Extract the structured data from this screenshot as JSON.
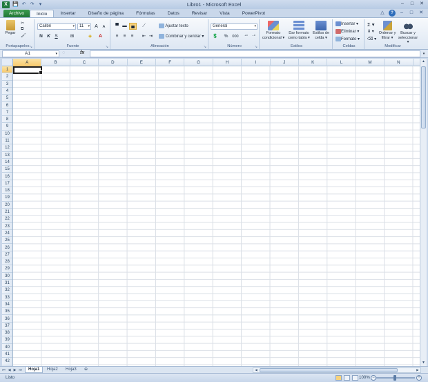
{
  "window": {
    "title": "Libro1 - Microsoft Excel",
    "app_letter": "X",
    "controls": [
      "–",
      "□",
      "✕"
    ]
  },
  "qat": [
    "💾",
    "↶",
    "↷",
    "▾"
  ],
  "tabs": [
    {
      "label": "Archivo"
    },
    {
      "label": "Inicio"
    },
    {
      "label": "Insertar"
    },
    {
      "label": "Diseño de página"
    },
    {
      "label": "Fórmulas"
    },
    {
      "label": "Datos"
    },
    {
      "label": "Revisar"
    },
    {
      "label": "Vista"
    },
    {
      "label": "PowerPivot"
    }
  ],
  "tab_right": {
    "minimize": "△",
    "help": "?",
    "min": "–",
    "restore": "□",
    "close": "✕"
  },
  "ribbon": {
    "portapapeles": {
      "label": "Portapapeles",
      "paste": "Pegar"
    },
    "fuente": {
      "label": "Fuente",
      "font": "Calibri",
      "size": "11",
      "grow": "A",
      "shrink": "A",
      "bold": "N",
      "italic": "K",
      "underline": "S"
    },
    "alineacion": {
      "label": "Alineación",
      "wrap": "Ajustar texto",
      "merge": "Combinar y centrar"
    },
    "numero": {
      "label": "Número",
      "format": "General",
      "percent": "%",
      "thousands": "000"
    },
    "estilos": {
      "label": "Estilos",
      "cond": "Formato condicional",
      "table": "Dar formato como tabla",
      "cell": "Estilos de celda"
    },
    "celdas": {
      "label": "Celdas",
      "insert": "Insertar",
      "delete": "Eliminar",
      "format": "Formato"
    },
    "modificar": {
      "label": "Modificar",
      "sort": "Ordenar y filtrar",
      "find": "Buscar y seleccionar",
      "sum": "Σ"
    }
  },
  "formula_bar": {
    "name_box": "A1",
    "fx": "fx",
    "value": ""
  },
  "grid": {
    "columns": [
      "A",
      "B",
      "C",
      "D",
      "E",
      "F",
      "G",
      "H",
      "I",
      "J",
      "K",
      "L",
      "M",
      "N"
    ],
    "rows": [
      "1",
      "2",
      "3",
      "4",
      "5",
      "6",
      "7",
      "8",
      "9",
      "10",
      "11",
      "12",
      "13",
      "14",
      "15",
      "16",
      "17",
      "18",
      "19",
      "20",
      "21",
      "22",
      "23",
      "24",
      "25",
      "26",
      "27",
      "28",
      "29",
      "30",
      "31",
      "32",
      "33",
      "34",
      "35",
      "36",
      "37",
      "38",
      "39",
      "40",
      "41",
      "42"
    ],
    "selected_cell": "A1"
  },
  "sheets": [
    {
      "label": "Hoja1"
    },
    {
      "label": "Hoja2"
    },
    {
      "label": "Hoja3"
    }
  ],
  "status": {
    "ready": "Listo",
    "zoom": "100%",
    "zoom_level_percent": 100
  }
}
